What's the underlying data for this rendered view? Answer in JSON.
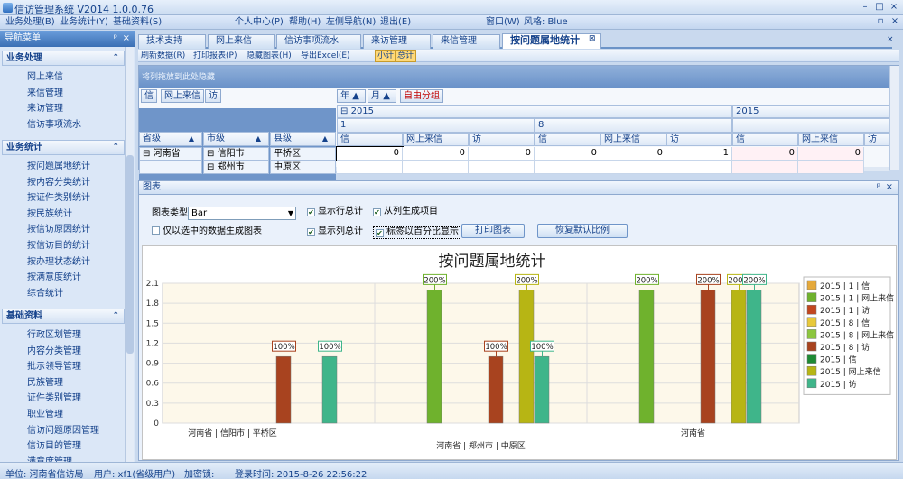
{
  "app": {
    "title": "信访管理系统 V2014 1.0.0.76"
  },
  "menu": {
    "left": [
      "业务处理(B)",
      "业务统计(Y)",
      "基础资料(S)"
    ],
    "right": [
      "个人中心(P)",
      "帮助(H)",
      "左侧导航(N)",
      "退出(E)"
    ],
    "window": "窗口(W)",
    "style_label": "风格: Blue"
  },
  "sidebar": {
    "title": "导航菜单",
    "sections": [
      {
        "title": "业务处理",
        "items": [
          "网上来信",
          "来信管理",
          "来访管理",
          "信访事项流水"
        ]
      },
      {
        "title": "业务统计",
        "items": [
          "按问题属地统计",
          "按内容分类统计",
          "按证件类别统计",
          "按民族统计",
          "按信访原因统计",
          "按信访目的统计",
          "按办理状态统计",
          "按满意度统计",
          "综合统计"
        ]
      },
      {
        "title": "基础资料",
        "items": [
          "行政区划管理",
          "内容分类管理",
          "批示领导管理",
          "民族管理",
          "证件类别管理",
          "职业管理",
          "信访问题原因管理",
          "信访目的管理",
          "满意度管理"
        ]
      }
    ]
  },
  "tabs": [
    "技术支持",
    "网上来信",
    "信访事项流水",
    "来访管理",
    "来信管理",
    "按问题属地统计"
  ],
  "toolbar": [
    "刷新数据(R)",
    "打印报表(P)",
    "隐藏图表(H)",
    "导出Excel(E)",
    "小计",
    "总计"
  ],
  "grid": {
    "group_hint": "将列拖放到此处隐藏",
    "data_fields": [
      "信",
      "网上来信",
      "访"
    ],
    "column_fields": [
      "年",
      "月",
      "自由分组"
    ],
    "row_fields": [
      "省级",
      "市级",
      "县级"
    ],
    "year_headers": [
      "2015",
      "2015"
    ],
    "month_headers": [
      "1",
      "8"
    ],
    "col_headers": [
      "信",
      "网上来信",
      "访",
      "信",
      "网上来信",
      "访",
      "信",
      "网上来信",
      "访"
    ],
    "rows": [
      {
        "province": "河南省",
        "city": "信阳市",
        "county": "平桥区",
        "values": [
          "0",
          "0",
          "0",
          "0",
          "0",
          "1",
          "0",
          "0"
        ]
      },
      {
        "province": "",
        "city": "郑州市",
        "county": "中原区",
        "values": [
          "",
          "",
          "",
          "",
          "",
          "",
          "",
          ""
        ]
      }
    ],
    "expanders": [
      "⊟",
      "⊟",
      "⊟",
      "⊟"
    ]
  },
  "chart_panel": {
    "title": "图表",
    "type_label": "图表类型:",
    "type_value": "Bar",
    "options": {
      "show_row_total": "显示行总计",
      "generate_from_columns": "从列生成项目",
      "only_selected": "仅以选中的数据生成图表",
      "show_col_total": "显示列总计",
      "percent_labels": "标签以百分比显示"
    },
    "checked": {
      "show_row_total": true,
      "generate_from_columns": true,
      "only_selected": false,
      "show_col_total": true,
      "percent_labels": true
    },
    "print_button": "打印图表",
    "reset_button": "恢复默认比例"
  },
  "chart_data": {
    "type": "bar",
    "title": "按问题属地统计",
    "categories": [
      "河南省 | 信阳市 | 平桥区",
      "河南省 | 郑州市 | 中原区",
      "河南省"
    ],
    "ylim": [
      0,
      2.1
    ],
    "yticks": [
      "0",
      "0.3",
      "0.6",
      "0.9",
      "1.2",
      "1.5",
      "1.8",
      "2.1"
    ],
    "series": [
      {
        "name": "2015 | 1 | 信",
        "color": "#e5a93b",
        "values": [
          0,
          0,
          0
        ]
      },
      {
        "name": "2015 | 1 | 网上来信",
        "color": "#6fb22d",
        "values": [
          0,
          2,
          2
        ]
      },
      {
        "name": "2015 | 1 | 访",
        "color": "#c2461f",
        "values": [
          0,
          0,
          0
        ]
      },
      {
        "name": "2015 | 8 | 信",
        "color": "#e8c93a",
        "values": [
          0,
          0,
          0
        ]
      },
      {
        "name": "2015 | 8 | 网上来信",
        "color": "#8cc63f",
        "values": [
          0,
          0,
          0
        ]
      },
      {
        "name": "2015 | 8 | 访",
        "color": "#a8431f",
        "values": [
          1,
          1,
          2
        ]
      },
      {
        "name": "2015 | 信",
        "color": "#1e8a34",
        "values": [
          0,
          0,
          0
        ]
      },
      {
        "name": "2015 | 网上来信",
        "color": "#b7b514",
        "values": [
          0,
          2,
          2
        ]
      },
      {
        "name": "2015 | 访",
        "color": "#3fb58a",
        "values": [
          1,
          1,
          2
        ]
      }
    ],
    "bar_labels": [
      {
        "category": 0,
        "series": 5,
        "text": "100%"
      },
      {
        "category": 0,
        "series": 8,
        "text": "100%"
      },
      {
        "category": 1,
        "series": 1,
        "text": "200%"
      },
      {
        "category": 1,
        "series": 5,
        "text": "100%"
      },
      {
        "category": 1,
        "series": 7,
        "text": "200%"
      },
      {
        "category": 1,
        "series": 8,
        "text": "100%"
      },
      {
        "category": 2,
        "series": 1,
        "text": "200%"
      },
      {
        "category": 2,
        "series": 5,
        "text": "200%"
      },
      {
        "category": 2,
        "series": 7,
        "text": "200%"
      },
      {
        "category": 2,
        "series": 8,
        "text": "200%"
      }
    ],
    "grid": true,
    "legend_position": "right"
  },
  "status": {
    "unit": "单位: 河南省信访局",
    "user": "用户: xf1(省级用户)",
    "lock": "加密锁:",
    "login": "登录时间: 2015-8-26 22:56:22"
  }
}
